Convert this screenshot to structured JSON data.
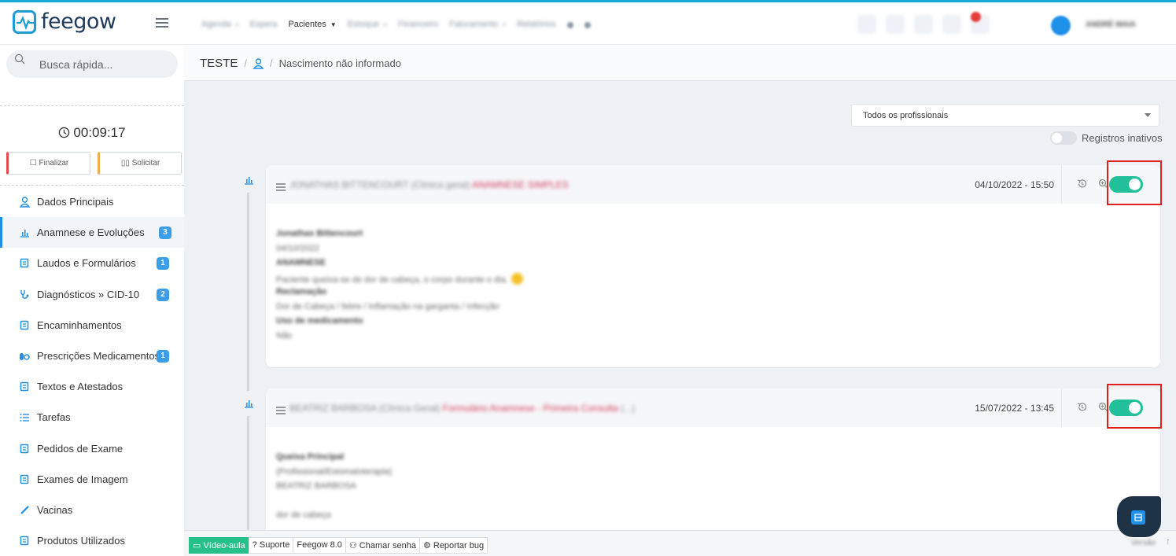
{
  "app": {
    "name": "feegow",
    "brand_color": "#1e9ad6"
  },
  "nav": {
    "items": [
      {
        "label": "Agenda",
        "blurred": true,
        "caret": true
      },
      {
        "label": "Espera",
        "blurred": true,
        "caret": false
      },
      {
        "label": "Pacientes",
        "blurred": false,
        "caret": true
      },
      {
        "label": "Estoque",
        "blurred": true,
        "caret": true
      },
      {
        "label": "Financeiro",
        "blurred": true,
        "caret": false
      },
      {
        "label": "Faturamento",
        "blurred": true,
        "caret": true
      },
      {
        "label": "Relatórios",
        "blurred": true,
        "caret": false
      }
    ],
    "user_name": "ANDRÉ MAIA",
    "notification_count": ""
  },
  "sidebar": {
    "search_placeholder": "Busca rápida...",
    "timer": "00:09:17",
    "finalizar_label": "Finalizar",
    "solicitar_label": "Solicitar",
    "items": [
      {
        "label": "Dados Principais",
        "icon": "user-icon",
        "count": ""
      },
      {
        "label": "Anamnese e Evoluções",
        "icon": "chart-icon",
        "count": "3"
      },
      {
        "label": "Laudos e Formulários",
        "icon": "clipboard-icon",
        "count": "1"
      },
      {
        "label": "Diagnósticos » CID-10",
        "icon": "stethoscope-icon",
        "count": "2"
      },
      {
        "label": "Encaminhamentos",
        "icon": "document-icon",
        "count": ""
      },
      {
        "label": "Prescrições Medicamentos",
        "icon": "pills-icon",
        "count": "1"
      },
      {
        "label": "Textos e Atestados",
        "icon": "certificate-icon",
        "count": ""
      },
      {
        "label": "Tarefas",
        "icon": "tasks-icon",
        "count": ""
      },
      {
        "label": "Pedidos de Exame",
        "icon": "lab-icon",
        "count": ""
      },
      {
        "label": "Exames de Imagem",
        "icon": "image-exam-icon",
        "count": ""
      },
      {
        "label": "Vacinas",
        "icon": "syringe-icon",
        "count": ""
      },
      {
        "label": "Produtos Utilizados",
        "icon": "box-icon",
        "count": ""
      }
    ]
  },
  "breadcrumb": {
    "patient": "TESTE",
    "separator": "/",
    "birth": "Nascimento não informado"
  },
  "filters": {
    "professional_select": "Todos os profissionais",
    "inactive_label": "Registros inativos",
    "inactive_on": false
  },
  "records": [
    {
      "author": "JONATHAS BITTENCOURT",
      "specialty": "(Clínica geral)",
      "form": "ANAMNESE SIMPLES",
      "form_extra": "",
      "date": "04/10/2022 - 15:50",
      "active": true,
      "body": [
        {
          "text": "Jonathas Bittencourt",
          "bold": true
        },
        {
          "text": "04/10/2022",
          "bold": false
        },
        {
          "text": "ANAMNESE",
          "bold": true
        },
        {
          "text": "Paciente queixa-se de dor de cabeça, o corpo durante o dia.",
          "bold": false,
          "emoji": true
        },
        {
          "text": "Reclamação",
          "bold": true
        },
        {
          "text": "Dor de Cabeça / febre / Inflamação na garganta / Infecção",
          "bold": false
        },
        {
          "text": "Uso de medicamento",
          "bold": true
        },
        {
          "text": "Não",
          "bold": false
        }
      ]
    },
    {
      "author": "BEATRIZ BARBOSA",
      "specialty": "(Clínica Geral)",
      "form": "Formulário Anamnese - Primeira Consulta",
      "form_extra": "(...)",
      "date": "15/07/2022 - 13:45",
      "active": true,
      "body": [
        {
          "text": "Queixa Principal",
          "bold": true
        },
        {
          "text": "(Profissional/Estomatoterapia)",
          "bold": false
        },
        {
          "text": "BEATRIZ BARBOSA",
          "bold": false
        },
        {
          "text": "",
          "bold": false
        },
        {
          "text": "dor de cabeça",
          "bold": false
        }
      ]
    }
  ],
  "footer": {
    "buttons": [
      "Vídeo-aula",
      "Suporte",
      "Feegow 8.0",
      "Chamar senha",
      "Reportar bug"
    ],
    "right_text": "Versão"
  },
  "colors": {
    "toggle_on": "#21c09a",
    "highlight": "#e02020",
    "accent": "#1e90e8"
  }
}
